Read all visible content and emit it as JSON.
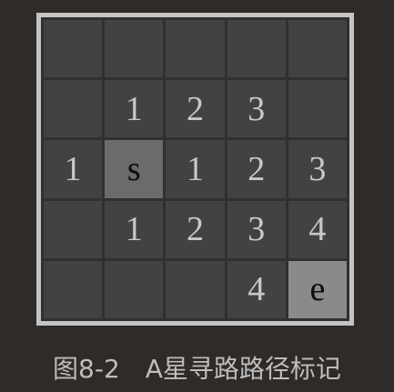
{
  "caption": "图8-2　A星寻路路径标记",
  "grid": {
    "rows": [
      [
        "",
        "",
        "",
        "",
        ""
      ],
      [
        "",
        "1",
        "2",
        "3",
        ""
      ],
      [
        "1",
        "s",
        "1",
        "2",
        "3"
      ],
      [
        "",
        "1",
        "2",
        "3",
        "4"
      ],
      [
        "",
        "",
        "",
        "4",
        "e"
      ]
    ],
    "start_label": "s",
    "end_label": "e"
  },
  "colors": {
    "background": "#2f2b28",
    "board_border": "#c4c4c4",
    "cell": "#424242",
    "start_cell": "#6b6b6b",
    "end_cell": "#8a8a8a",
    "number_text": "#c8c8c8"
  }
}
